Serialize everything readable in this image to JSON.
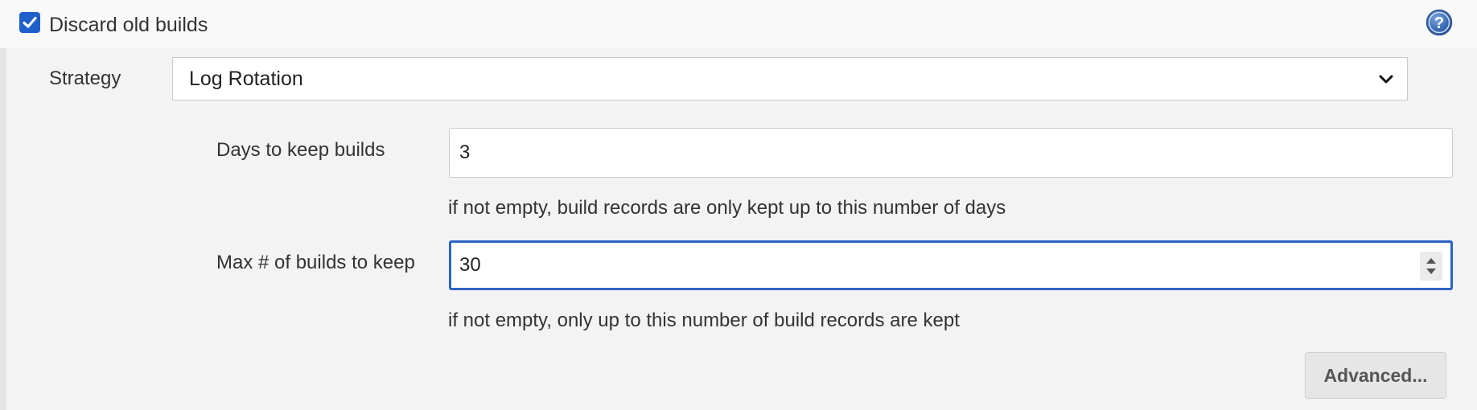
{
  "discard": {
    "label": "Discard old builds",
    "checked": true
  },
  "help": {
    "icon": "help-icon",
    "glyph": "?"
  },
  "strategy": {
    "label": "Strategy",
    "selected": "Log Rotation"
  },
  "days_to_keep": {
    "label": "Days to keep builds",
    "value": "3",
    "hint": "if not empty, build records are only kept up to this number of days"
  },
  "max_builds": {
    "label": "Max # of builds to keep",
    "value": "30",
    "hint": "if not empty, only up to this number of build records are kept"
  },
  "advanced_button": {
    "label": "Advanced..."
  },
  "colors": {
    "accent": "#1f5fc9",
    "focus_border": "#2b63c4",
    "background": "#f3f3f3"
  }
}
